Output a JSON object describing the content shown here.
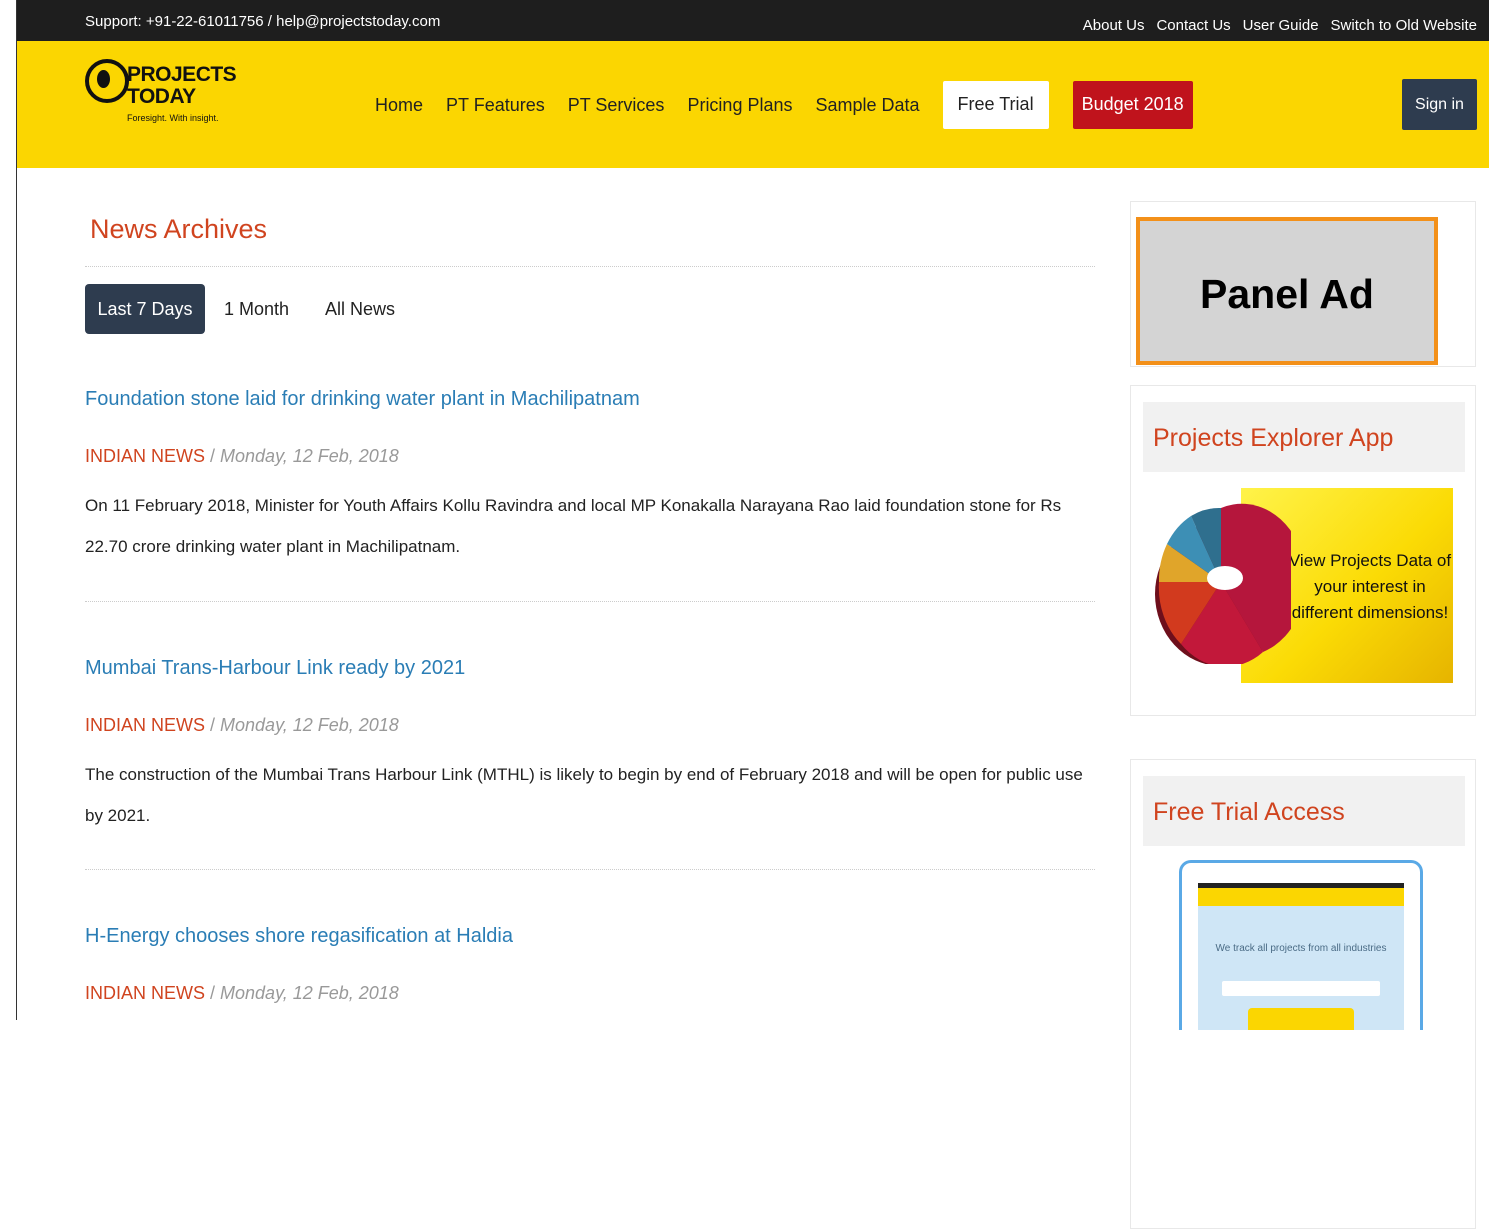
{
  "topbar": {
    "support": "Support: +91-22-61011756 / help@projectstoday.com",
    "links": [
      "About Us",
      "Contact Us",
      "User Guide",
      "Switch to Old Website"
    ]
  },
  "logo": {
    "line1": "PROJECTS",
    "line2": "TODAY",
    "tagline": "Foresight. With insight."
  },
  "nav": {
    "items": [
      "Home",
      "PT Features",
      "PT Services",
      "Pricing Plans",
      "Sample Data"
    ],
    "free_trial": "Free Trial",
    "budget": "Budget 2018",
    "signin": "Sign in"
  },
  "main": {
    "title": "News Archives",
    "tabs": [
      "Last 7 Days",
      "1 Month",
      "All News"
    ],
    "articles": [
      {
        "title": "Foundation stone laid for drinking water plant in Machilipatnam",
        "category": "INDIAN NEWS",
        "sep": " / ",
        "date": "Monday, 12 Feb, 2018",
        "body": "On 11 February 2018, Minister for Youth Affairs Kollu Ravindra and local MP Konakalla Narayana Rao laid foundation stone for Rs 22.70 crore drinking water plant in Machilipatnam."
      },
      {
        "title": "Mumbai Trans-Harbour Link ready by 2021",
        "category": "INDIAN NEWS",
        "sep": " / ",
        "date": "Monday, 12 Feb, 2018",
        "body": "The construction of the Mumbai Trans Harbour Link (MTHL) is likely to begin by end of February 2018 and will be open for public use by 2021."
      },
      {
        "title": "H-Energy chooses shore regasification at Haldia",
        "category": "INDIAN NEWS",
        "sep": " / ",
        "date": "Monday, 12 Feb, 2018"
      }
    ]
  },
  "sidebar": {
    "panel_ad": "Panel Ad",
    "app": {
      "title": "Projects Explorer App",
      "banner_text": "View Projects Data of your interest in different dimensions!"
    },
    "free_trial": {
      "title": "Free Trial Access",
      "mock_text": "We track all projects from all industries"
    }
  },
  "colors": {
    "header": "#fbd601",
    "topbar": "#1e1e1e",
    "accent": "#d0441f",
    "link": "#2a7db5",
    "budget": "#c0131c",
    "dark_button": "#2e3c4f"
  }
}
